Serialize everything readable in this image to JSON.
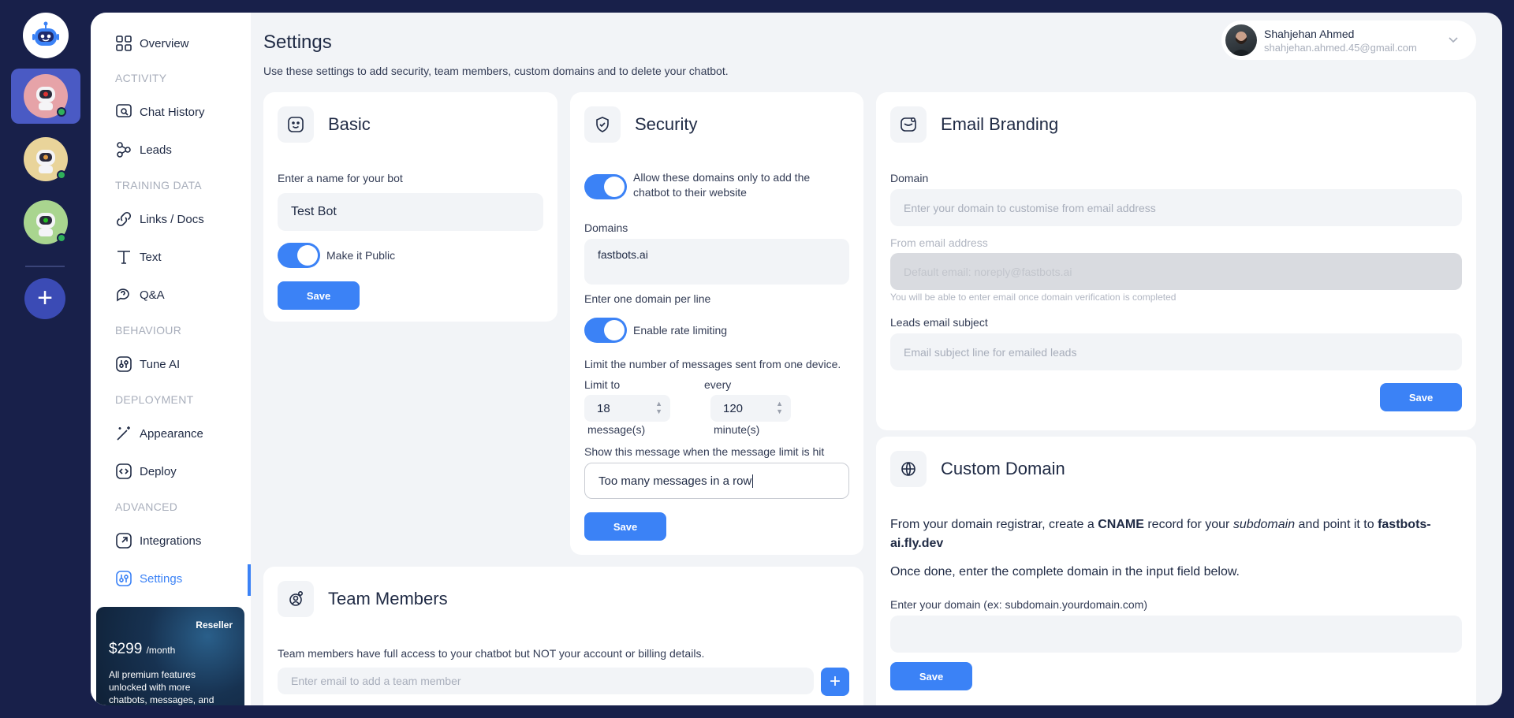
{
  "page": {
    "title": "Settings",
    "subtitle": "Use these settings to add security, team members, custom domains and to delete your chatbot."
  },
  "user": {
    "name": "Shahjehan Ahmed",
    "email": "shahjehan.ahmed.45@gmail.com"
  },
  "sidebar": {
    "overview": "Overview",
    "sections": {
      "activity": "ACTIVITY",
      "training": "TRAINING DATA",
      "behaviour": "BEHAVIOUR",
      "deployment": "DEPLOYMENT",
      "advanced": "ADVANCED"
    },
    "items": {
      "chat_history": "Chat History",
      "leads": "Leads",
      "links_docs": "Links / Docs",
      "text": "Text",
      "qa": "Q&A",
      "tune_ai": "Tune AI",
      "appearance": "Appearance",
      "deploy": "Deploy",
      "integrations": "Integrations",
      "settings": "Settings"
    },
    "promo": {
      "badge": "Reseller",
      "price": "$299",
      "period": "/month",
      "desc": "All premium features unlocked with more chatbots, messages, and"
    }
  },
  "basic": {
    "title": "Basic",
    "name_label": "Enter a name for your bot",
    "name_value": "Test Bot",
    "public_label": "Make it Public",
    "save": "Save"
  },
  "security": {
    "title": "Security",
    "allow_domains_label": "Allow these domains only to add the chatbot to their website",
    "domains_label": "Domains",
    "domains_value": "fastbots.ai",
    "domains_hint": "Enter one domain per line",
    "rate_limit_label": "Enable rate limiting",
    "limit_desc": "Limit the number of messages sent from one device.",
    "limit_to_label": "Limit to",
    "limit_to_value": "18",
    "limit_to_unit": "message(s)",
    "every_label": "every",
    "every_value": "120",
    "every_unit": "minute(s)",
    "limit_msg_label": "Show this message when the message limit is hit",
    "limit_msg_value": "Too many messages in a row",
    "save": "Save"
  },
  "email_branding": {
    "title": "Email Branding",
    "domain_label": "Domain",
    "domain_placeholder": "Enter your domain to customise from email address",
    "from_label": "From email address",
    "from_placeholder": "Default email: noreply@fastbots.ai",
    "from_hint": "You will be able to enter email once domain verification is completed",
    "subject_label": "Leads email subject",
    "subject_placeholder": "Email subject line for emailed leads",
    "save": "Save"
  },
  "custom_domain": {
    "title": "Custom Domain",
    "p1_a": "From your domain registrar, create a ",
    "p1_b": "CNAME",
    "p1_c": " record for your ",
    "p1_d": "subdomain",
    "p1_e": " and point it to ",
    "p1_f": "fastbots-ai.fly.dev",
    "p2": "Once done, enter the complete domain in the input field below.",
    "input_label": "Enter your domain (ex: subdomain.yourdomain.com)",
    "save": "Save"
  },
  "team": {
    "title": "Team Members",
    "desc": "Team members have full access to your chatbot but NOT your account or billing details.",
    "email_placeholder": "Enter email to add a team member"
  },
  "colors": {
    "accent": "#3b82f6",
    "rail": "#18204a",
    "active_bot": "#4a5ac4",
    "online": "#2fb05a"
  }
}
